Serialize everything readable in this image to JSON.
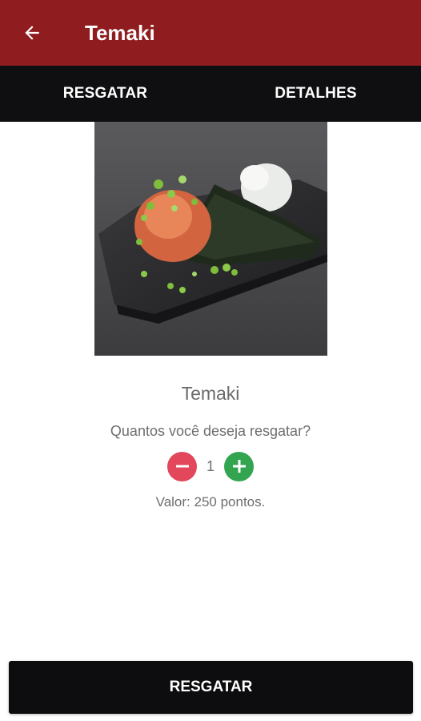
{
  "app_bar": {
    "title": "Temaki",
    "back_icon": "arrow-left-icon",
    "background": "#8f1c1f"
  },
  "tabs": [
    {
      "label": "RESGATAR"
    },
    {
      "label": "DETALHES"
    }
  ],
  "product": {
    "name": "Temaki",
    "image_icon": "temaki-photo"
  },
  "redeem": {
    "question": "Quantos você deseja resgatar?",
    "quantity": "1",
    "minus_icon": "minus-icon",
    "plus_icon": "plus-icon",
    "price_text": "Valor: 250 pontos.",
    "button_label": "RESGATAR"
  },
  "colors": {
    "tab_bar": "#0f0f11",
    "minus": "#e2475b",
    "plus": "#33a550"
  }
}
